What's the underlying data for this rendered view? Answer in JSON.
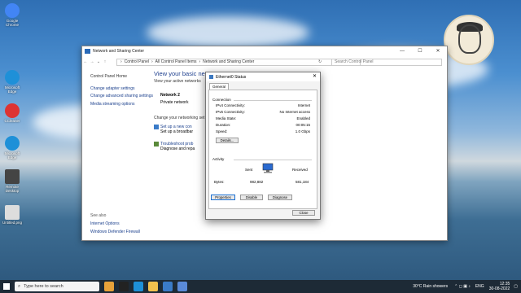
{
  "desktop": {
    "icons": [
      {
        "label": "Google Chrome",
        "color": "#4285f4"
      },
      {
        "label": "Microsoft Edge",
        "color": "#1e90d8"
      },
      {
        "label": "CCleaner",
        "color": "#d33"
      },
      {
        "label": "Microsoft Edge",
        "color": "#1e90d8"
      },
      {
        "label": "Remote Desktop",
        "color": "#444"
      },
      {
        "label": "Untitled.png",
        "color": "#ddd"
      }
    ]
  },
  "window": {
    "title": "Network and Sharing Center",
    "controls": [
      "—",
      "☐",
      "✕"
    ],
    "address": {
      "back": "←",
      "forward": "→",
      "down": "⌄",
      "up": "↑",
      "crumbs": [
        "›",
        "Control Panel",
        "›",
        "All Control Panel Items",
        "›",
        "Network and Sharing Center"
      ],
      "refresh": "↻",
      "search_placeholder": "Search Control Panel"
    },
    "sidebar": {
      "home": "Control Panel Home",
      "items": [
        "Change adapter settings",
        "Change advanced sharing settings",
        "Media streaming options"
      ]
    },
    "see_also": {
      "heading": "See also",
      "items": [
        "Internet Options",
        "Windows Defender Firewall"
      ]
    },
    "main": {
      "heading": "View your basic netw",
      "active": "View your active networks",
      "network_name": "Network 2",
      "network_type": "Private network",
      "change": "Change your networking set",
      "tasks": [
        {
          "link": "Set up a new con",
          "desc": "Set up a broadbar"
        },
        {
          "link": "Troubleshoot prob",
          "desc": "Diagnose and repa"
        }
      ]
    }
  },
  "dialog": {
    "title": "Ethernet0 Status",
    "close": "✕",
    "tab": "General",
    "connection": {
      "heading": "Connection",
      "rows": [
        {
          "label": "IPv4 Connectivity:",
          "value": "Internet"
        },
        {
          "label": "IPv6 Connectivity:",
          "value": "No Internet access"
        },
        {
          "label": "Media State:",
          "value": "Enabled"
        },
        {
          "label": "Duration:",
          "value": "00:05:15"
        },
        {
          "label": "Speed:",
          "value": "1.0 Gbps"
        }
      ],
      "details_button": "Details..."
    },
    "activity": {
      "heading": "Activity",
      "sent_label": "Sent",
      "received_label": "Received",
      "bytes_label": "Bytes:",
      "sent_value": "982,882",
      "received_value": "581,184"
    },
    "buttons": {
      "properties": "Properties",
      "disable": "Disable",
      "diagnose": "Diagnose",
      "close": "Close"
    }
  },
  "taskbar": {
    "search_placeholder": "Type here to search",
    "weather": "30°C  Rain showers",
    "language": "ENG",
    "time": "12:35",
    "date": "30-08-2022"
  }
}
